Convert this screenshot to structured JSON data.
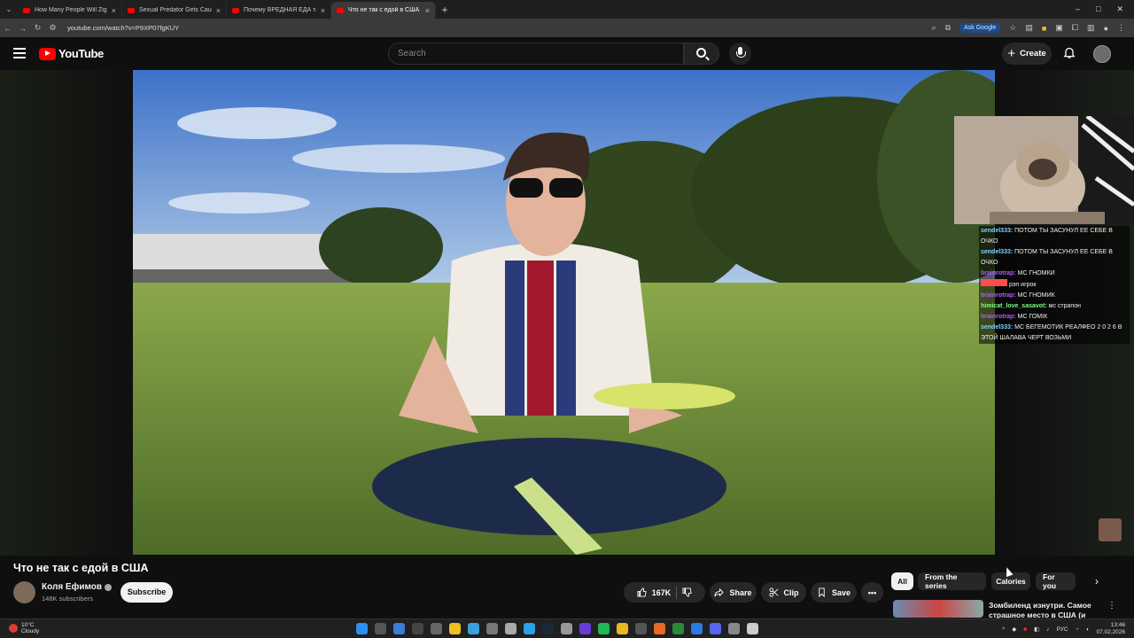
{
  "browser": {
    "tabs": [
      {
        "title": "How Many People Will Zigant..."
      },
      {
        "title": "Sexual Predator Gets Caught in..."
      },
      {
        "title": "Почему ВРЕДНАЯ ЕДА такая В..."
      },
      {
        "title": "Что не так с едой в США"
      }
    ],
    "url": "youtube.com/watch?v=P9XP07fgKUY",
    "ask_google": "Ask Google",
    "new_tab": "+"
  },
  "header": {
    "logo_text": "YouTube",
    "search_placeholder": "Search",
    "create_label": "Create"
  },
  "chat": {
    "messages": [
      {
        "user": "sendel333:",
        "text": "ПОТОМ ТЫ ЗАСУНУЛ ЕЕ СЕБЕ В ОЧКО",
        "color": "#7fd3ff"
      },
      {
        "user": "sendel333:",
        "text": "ПОТОМ ТЫ ЗАСУНУЛ ЕЕ СЕБЕ В ОЧКО",
        "color": "#7fd3ff"
      },
      {
        "user": "brainrotrap:",
        "text": "МС ГНОМКИ",
        "color": "#b05cff"
      },
      {
        "user": "",
        "text": "рэп игрок",
        "color": "#ff4d4d"
      },
      {
        "user": "brainrotrap:",
        "text": "МС ГНОМИК",
        "color": "#b05cff"
      },
      {
        "user": "himicat_love_sasavot:",
        "text": "мс страпон",
        "color": "#7cff7c"
      },
      {
        "user": "brainrotrap:",
        "text": "МС ГОМІК",
        "color": "#b05cff"
      },
      {
        "user": "sendel333:",
        "text": "МС БЕГЕМОТИК РЕАЛФЕО 2 0 2 6 В ЭТОЙ ШАЛАВА ЧЕРТ ВОЗЬМИ",
        "color": "#7fd3ff"
      }
    ]
  },
  "video": {
    "title": "Что не так с едой в США",
    "channel": "Коля Ефимов",
    "subscribers": "148K subscribers",
    "subscribe_label": "Subscribe",
    "likes": "167K",
    "share_label": "Share",
    "clip_label": "Clip",
    "save_label": "Save"
  },
  "chips": [
    "All",
    "From the series",
    "Calories",
    "For you"
  ],
  "recommendation": {
    "title": "Зомбиленд изнутри. Самое страшное место в США (и в..."
  },
  "taskbar": {
    "temp": "10°C",
    "weather": "Cloudy",
    "lang": "РУС",
    "time": "13:46",
    "date": "07.02.2026"
  },
  "colors": {
    "accent": "#ff0000",
    "background": "#0f0f0f"
  }
}
